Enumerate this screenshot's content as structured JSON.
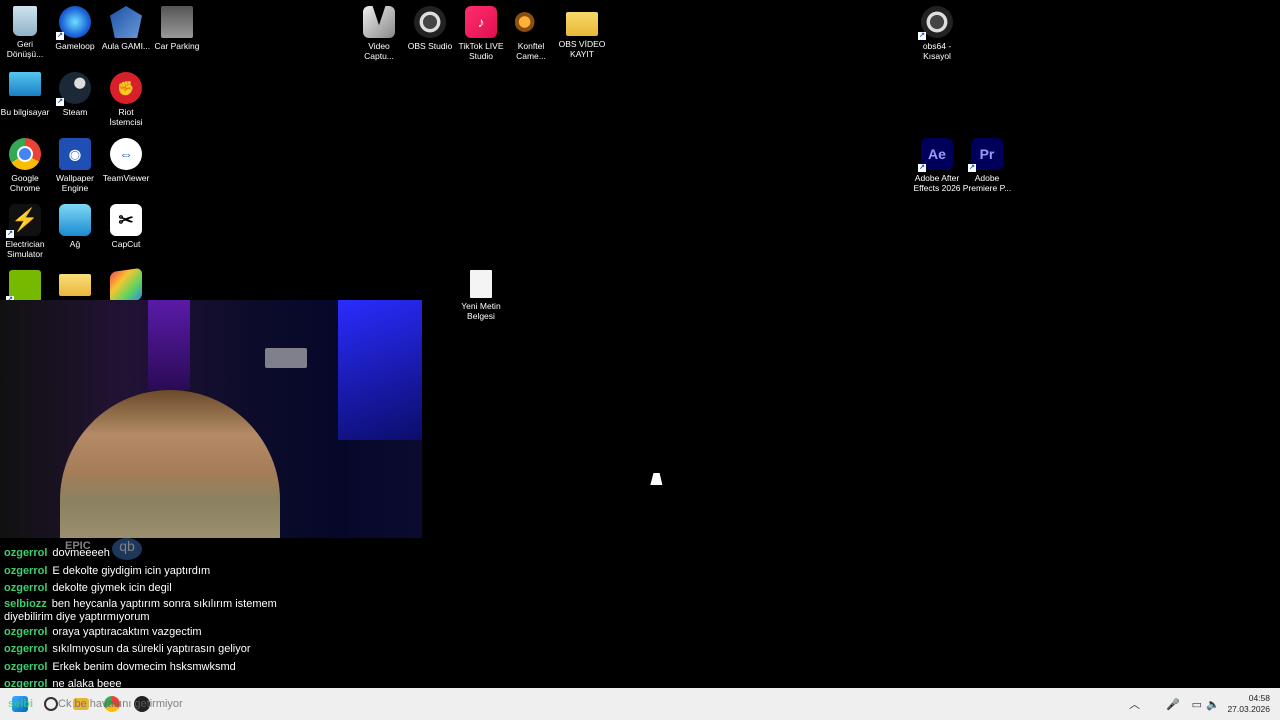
{
  "desktop": {
    "icons": [
      {
        "label": "Geri Dönüşü...",
        "icon": "recycle-bin-icon"
      },
      {
        "label": "Gameloop",
        "icon": "gameloop-icon"
      },
      {
        "label": "Aula GAMI...",
        "icon": "aula-gaming-icon"
      },
      {
        "label": "Car Parking",
        "icon": "car-parking-icon"
      },
      {
        "label": "Video Captu...",
        "icon": "video-capture-icon"
      },
      {
        "label": "OBS Studio",
        "icon": "obs-icon"
      },
      {
        "label": "TikTok LIVE Studio",
        "icon": "tiktok-icon"
      },
      {
        "label": "Konftel Came...",
        "icon": "konftel-icon"
      },
      {
        "label": "OBS VİDEO KAYIT",
        "icon": "folder-icon"
      },
      {
        "label": "obs64 - Kısayol",
        "icon": "obs-icon"
      },
      {
        "label": "Bu bilgisayar",
        "icon": "computer-icon"
      },
      {
        "label": "Steam",
        "icon": "steam-icon"
      },
      {
        "label": "Riot İstemcisi",
        "icon": "riot-icon"
      },
      {
        "label": "Google Chrome",
        "icon": "chrome-icon"
      },
      {
        "label": "Wallpaper Engine",
        "icon": "wallpaper-engine-icon"
      },
      {
        "label": "TeamViewer",
        "icon": "teamviewer-icon"
      },
      {
        "label": "Adobe After Effects 2026",
        "icon": "after-effects-icon"
      },
      {
        "label": "Adobe Premiere P...",
        "icon": "premiere-icon"
      },
      {
        "label": "Electrician Simulator",
        "icon": "electrician-icon"
      },
      {
        "label": "Ağ",
        "icon": "network-icon"
      },
      {
        "label": "CapCut",
        "icon": "capcut-icon"
      },
      {
        "label": "",
        "icon": "nvidia-icon"
      },
      {
        "label": "",
        "icon": "folder-icon"
      },
      {
        "label": "",
        "icon": "bluestacks-icon"
      },
      {
        "label": "Yeni Metin Belgesi",
        "icon": "text-file-icon"
      }
    ],
    "glyphs": {
      "after_effects": "Ae",
      "premiere": "Pr",
      "epic": "EPIC",
      "qb": "qb"
    }
  },
  "chat": {
    "messages": [
      {
        "user": "ozgerrol",
        "text": "dovmeeeeh"
      },
      {
        "user": "ozgerrol",
        "text": "E dekolte giydigim icin yaptırdım"
      },
      {
        "user": "ozgerrol",
        "text": "dekolte giymek icin degil"
      },
      {
        "user": "selbiozz",
        "text": "ben heycanla yaptırım sonra sıkılırım istemem diyebilirim diye yaptırmıyorum"
      },
      {
        "user": "ozgerrol",
        "text": "oraya yaptıracaktım vazgectim"
      },
      {
        "user": "ozgerrol",
        "text": "sıkılmıyosun da sürekli yaptırasın geliyor"
      },
      {
        "user": "ozgerrol",
        "text": "Erkek benim dovmecim hsksmwksmd"
      },
      {
        "user": "ozgerrol",
        "text": "ne alaka beee"
      }
    ],
    "overlay_text": "Ck be havasını getirmiyor",
    "overlay_user": "selbi"
  },
  "taskbar": {
    "time": "04:58",
    "date": "27.03.2026"
  },
  "colors": {
    "chat_user": "#3ecf6e",
    "taskbar_bg": "#efefef"
  }
}
